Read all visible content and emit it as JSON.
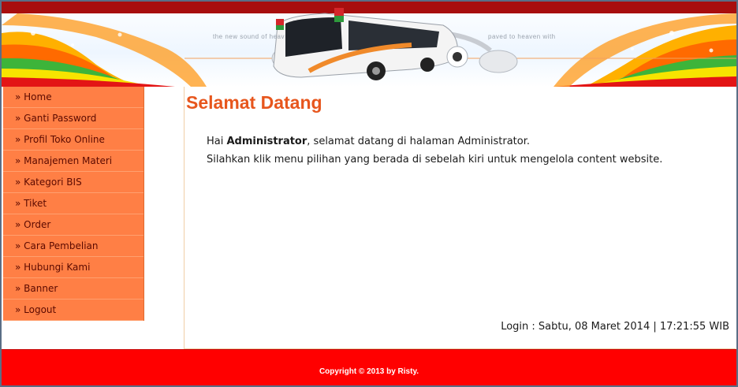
{
  "header": {
    "tagline_left": "the new sound of heav",
    "tagline_right": "paved to heaven with"
  },
  "sidebar": {
    "items": [
      {
        "label": "» Home"
      },
      {
        "label": "» Ganti Password"
      },
      {
        "label": "» Profil Toko Online"
      },
      {
        "label": "» Manajemen Materi"
      },
      {
        "label": "» Kategori BIS"
      },
      {
        "label": "» Tiket"
      },
      {
        "label": "» Order"
      },
      {
        "label": "» Cara Pembelian"
      },
      {
        "label": "» Hubungi Kami"
      },
      {
        "label": "» Banner"
      },
      {
        "label": "» Logout"
      }
    ]
  },
  "main": {
    "title": "Selamat Datang",
    "greeting_prefix": "Hai ",
    "user_name": "Administrator",
    "greeting_suffix": ", selamat datang di halaman Administrator.",
    "instruction": "Silahkan klik menu pilihan yang berada di sebelah kiri untuk mengelola content website.",
    "login_info": "Login : Sabtu, 08 Maret 2014 | 17:21:55 WIB"
  },
  "footer": {
    "copyright": "Copyright © 2013 by Risty."
  },
  "colors": {
    "accent": "#e7561d",
    "sidebar_bg": "#ff7f45",
    "footer_bg": "#ff0000",
    "header_top": "#a80e0e"
  }
}
